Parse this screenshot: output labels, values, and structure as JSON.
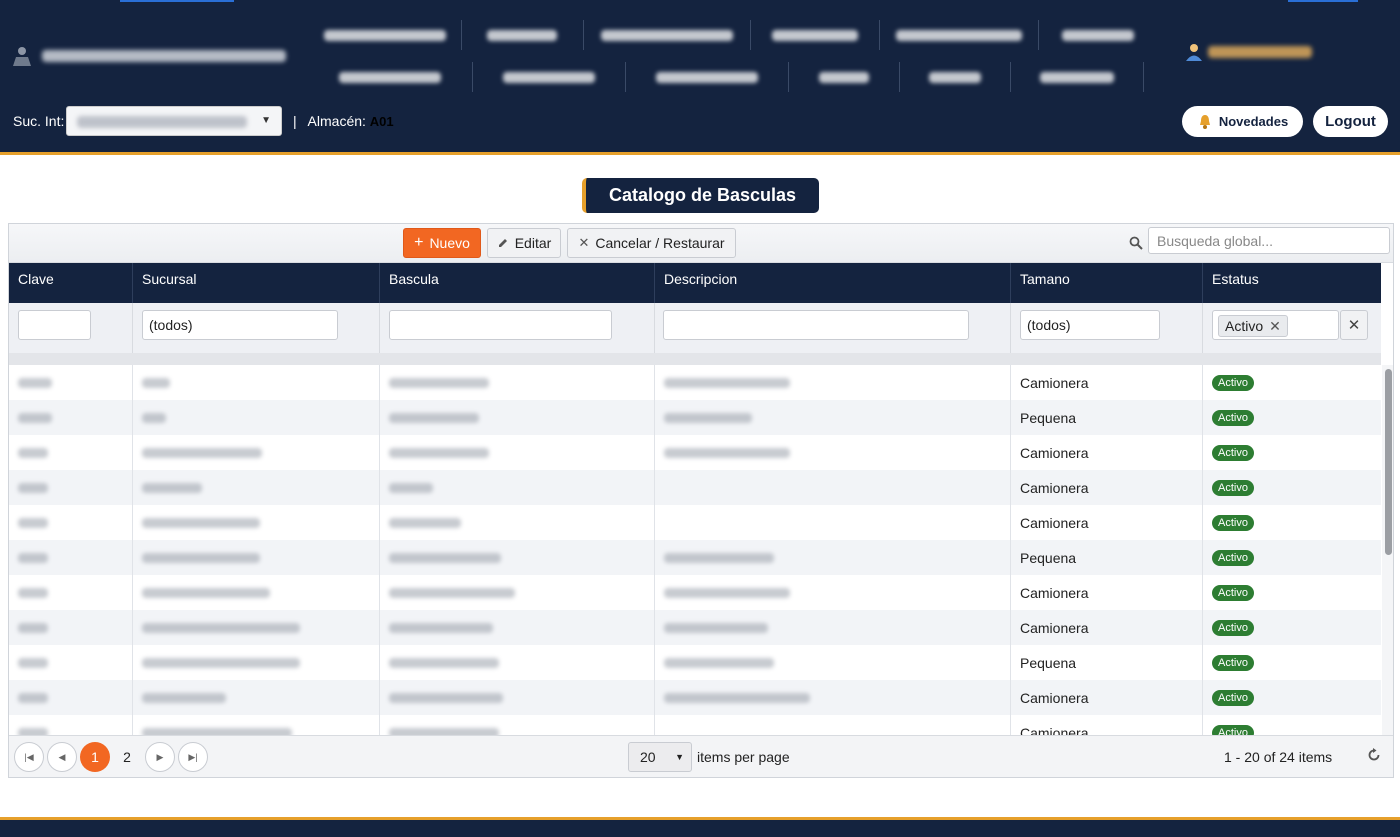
{
  "header": {
    "menu_rows": [
      [
        "",
        "",
        "",
        "",
        "",
        ""
      ],
      [
        "",
        "",
        "",
        "",
        "",
        ""
      ]
    ],
    "sucursal_label": "Suc. Int:",
    "almacen_label": "Almacén:",
    "almacen_value": "A01",
    "separator": "|",
    "novedades_label": "Novedades",
    "logout_label": "Logout"
  },
  "page": {
    "title": "Catalogo de Basculas"
  },
  "toolbar": {
    "new_label": "Nuevo",
    "edit_label": "Editar",
    "cancel_label": "Cancelar / Restaurar",
    "search_placeholder": "Busqueda global..."
  },
  "columns": [
    "Clave",
    "Sucursal",
    "Bascula",
    "Descripcion",
    "Tamano",
    "Estatus"
  ],
  "filters": {
    "sucursal": "(todos)",
    "tamano": "(todos)",
    "estatus_chip": "Activo"
  },
  "rows": [
    {
      "tamano": "Camionera",
      "estatus": "Activo"
    },
    {
      "tamano": "Pequena",
      "estatus": "Activo"
    },
    {
      "tamano": "Camionera",
      "estatus": "Activo"
    },
    {
      "tamano": "Camionera",
      "estatus": "Activo"
    },
    {
      "tamano": "Camionera",
      "estatus": "Activo"
    },
    {
      "tamano": "Pequena",
      "estatus": "Activo"
    },
    {
      "tamano": "Camionera",
      "estatus": "Activo"
    },
    {
      "tamano": "Camionera",
      "estatus": "Activo"
    },
    {
      "tamano": "Pequena",
      "estatus": "Activo"
    },
    {
      "tamano": "Camionera",
      "estatus": "Activo"
    },
    {
      "tamano": "Camionera",
      "estatus": "Activo"
    }
  ],
  "pager": {
    "pages": [
      "1",
      "2"
    ],
    "current_page": "1",
    "page_size": "20",
    "page_size_label": "items per page",
    "range_text": "1 - 20 of 24 items"
  },
  "colors": {
    "header_bg": "#14233f",
    "accent": "#e6a02b",
    "primary_button": "#f26722",
    "status_badge": "#2d7d32"
  }
}
